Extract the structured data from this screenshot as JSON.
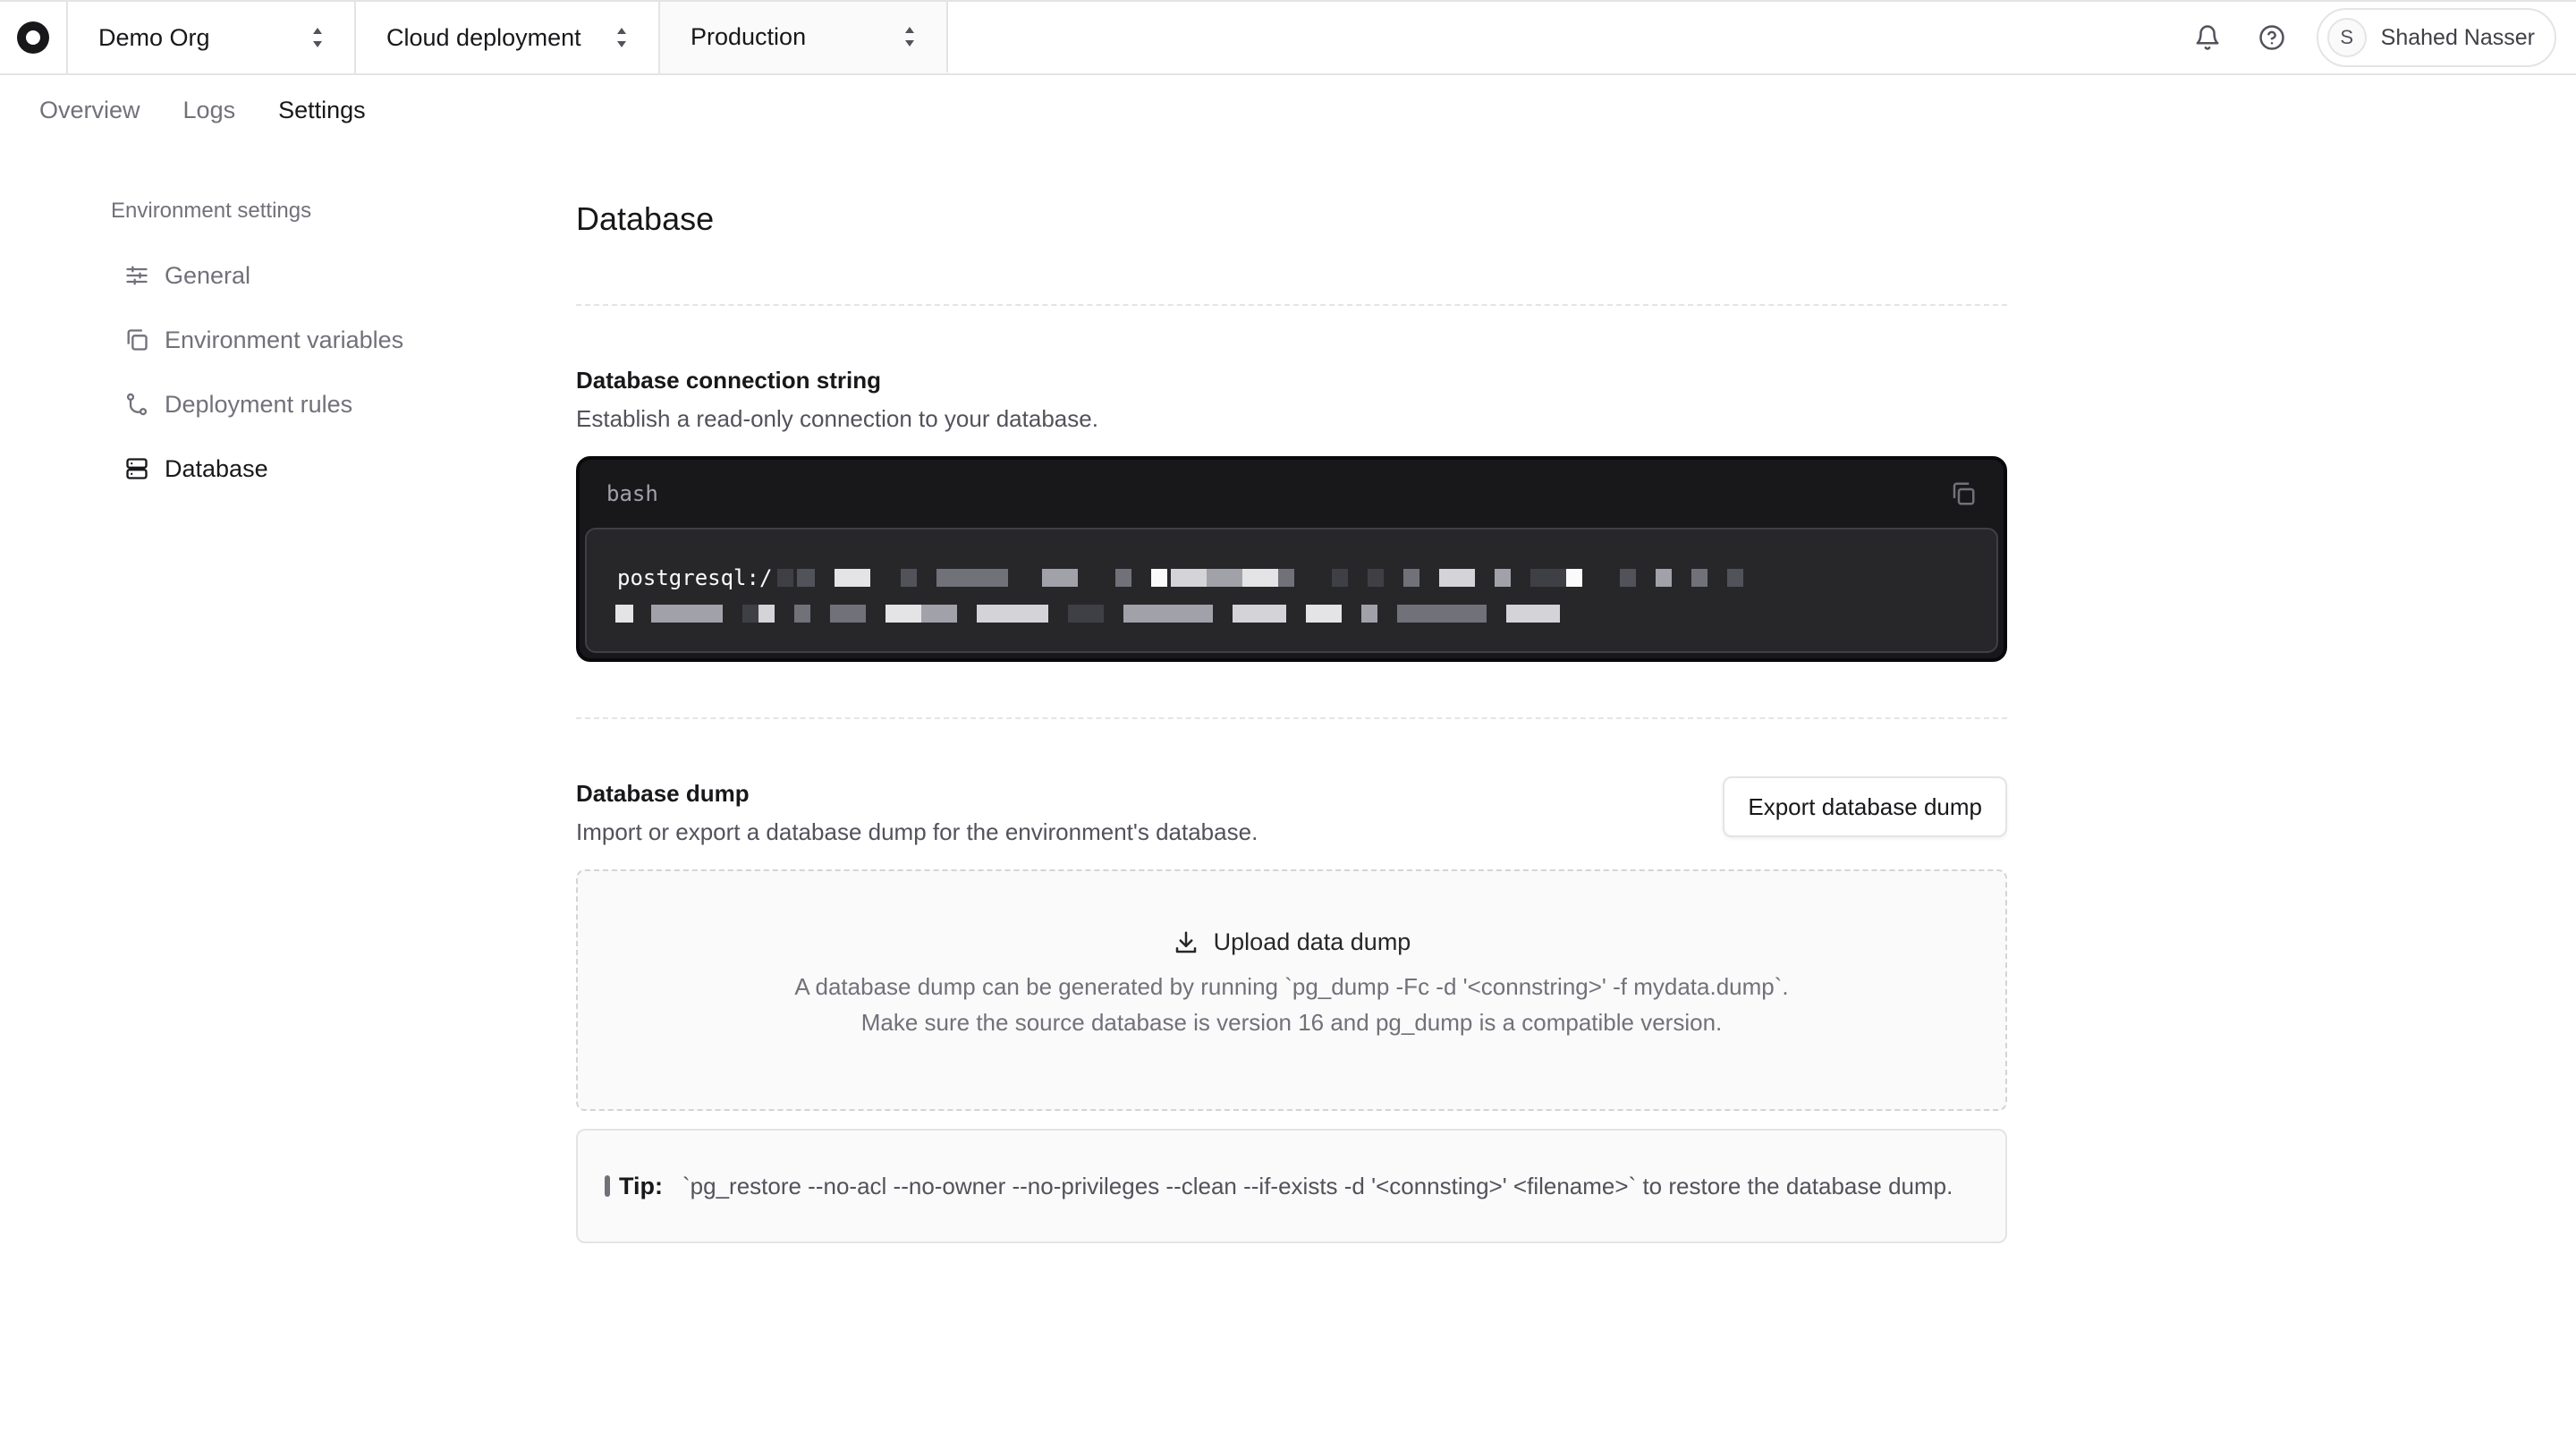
{
  "topbar": {
    "org": "Demo Org",
    "project": "Cloud deployment",
    "environment": "Production",
    "user": {
      "initial": "S",
      "name": "Shahed Nasser"
    }
  },
  "tabs": [
    {
      "label": "Overview",
      "active": false
    },
    {
      "label": "Logs",
      "active": false
    },
    {
      "label": "Settings",
      "active": true
    }
  ],
  "sidebar": {
    "heading": "Environment settings",
    "items": [
      {
        "label": "General",
        "icon": "sliders-icon",
        "active": false
      },
      {
        "label": "Environment variables",
        "icon": "copy-icon",
        "active": false
      },
      {
        "label": "Deployment rules",
        "icon": "git-branch-icon",
        "active": false
      },
      {
        "label": "Database",
        "icon": "server-icon",
        "active": true
      }
    ]
  },
  "main": {
    "title": "Database",
    "connection": {
      "title": "Database connection string",
      "description": "Establish a read-only connection to your database.",
      "language": "bash",
      "code_prefix": "postgresql:/"
    },
    "dump": {
      "title": "Database dump",
      "description": "Import or export a database dump for the environment's database.",
      "export_label": "Export database dump",
      "upload_label": "Upload data dump",
      "hint_line1": "A database dump can be generated by running `pg_dump -Fc -d '<connstring>' -f mydata.dump`.",
      "hint_line2": "Make sure the source database is version 16 and pg_dump is a compatible version."
    },
    "tip": {
      "label": "Tip:",
      "text": "`pg_restore --no-acl --no-owner --no-privileges --clean --if-exists -d '<connsting>' <filename>` to restore the database dump."
    }
  },
  "colors": {
    "code_bg": "#18181b",
    "text_primary": "#18181b",
    "text_muted": "#71717a",
    "border": "#e4e4e7"
  }
}
